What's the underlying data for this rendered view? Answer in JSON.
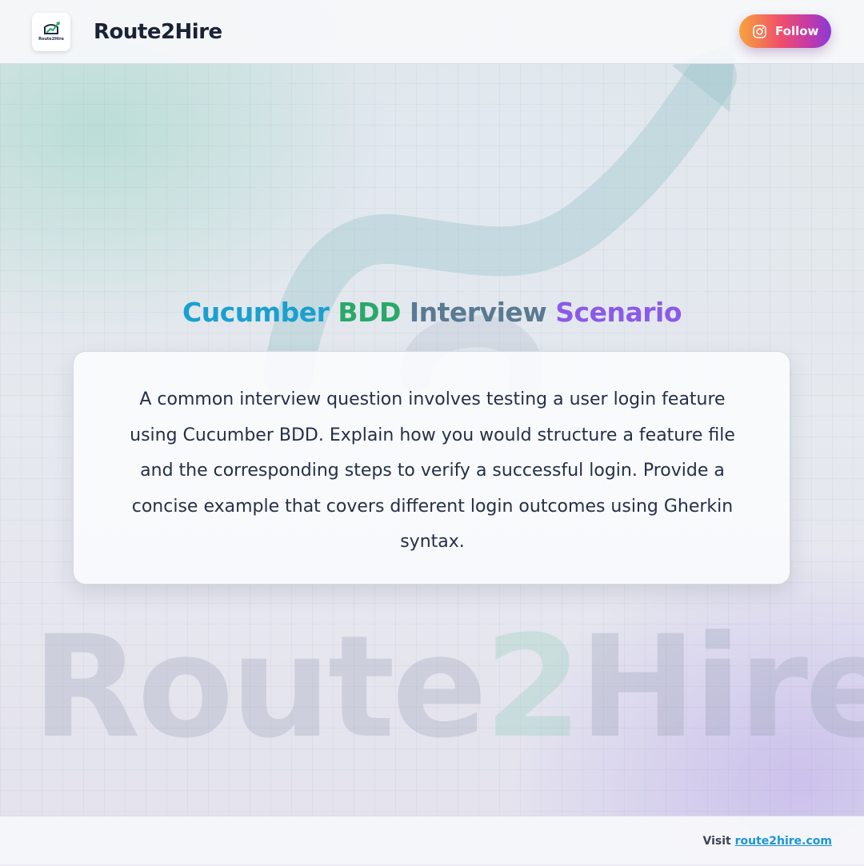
{
  "header": {
    "logo_text": "Route2Hire",
    "brand": "Route2Hire",
    "follow_label": "Follow",
    "follow_icon": "instagram-icon"
  },
  "title": {
    "word1": "Cucumber",
    "word2": "BDD",
    "word3": "Interview",
    "word4": "Scenario"
  },
  "card": {
    "text": "A common interview question involves testing a user login feature using Cucumber BDD. Explain how you would structure a feature file and the corresponding steps to verify a successful login. Provide a concise example that covers different login outcomes using Gherkin syntax."
  },
  "watermark": {
    "part1": "Route",
    "part2": "2",
    "part3": "Hire"
  },
  "footer": {
    "prefix": "Visit",
    "link": "route2hire.com"
  },
  "colors": {
    "title_word1": "#1aa0cf",
    "title_word2": "#2aa86a",
    "title_word3": "#5a7a92",
    "title_word4": "#8b5ae6",
    "link": "#1a95d3",
    "follow_gradient_start": "#f7a43a",
    "follow_gradient_end": "#8a3ad6"
  }
}
